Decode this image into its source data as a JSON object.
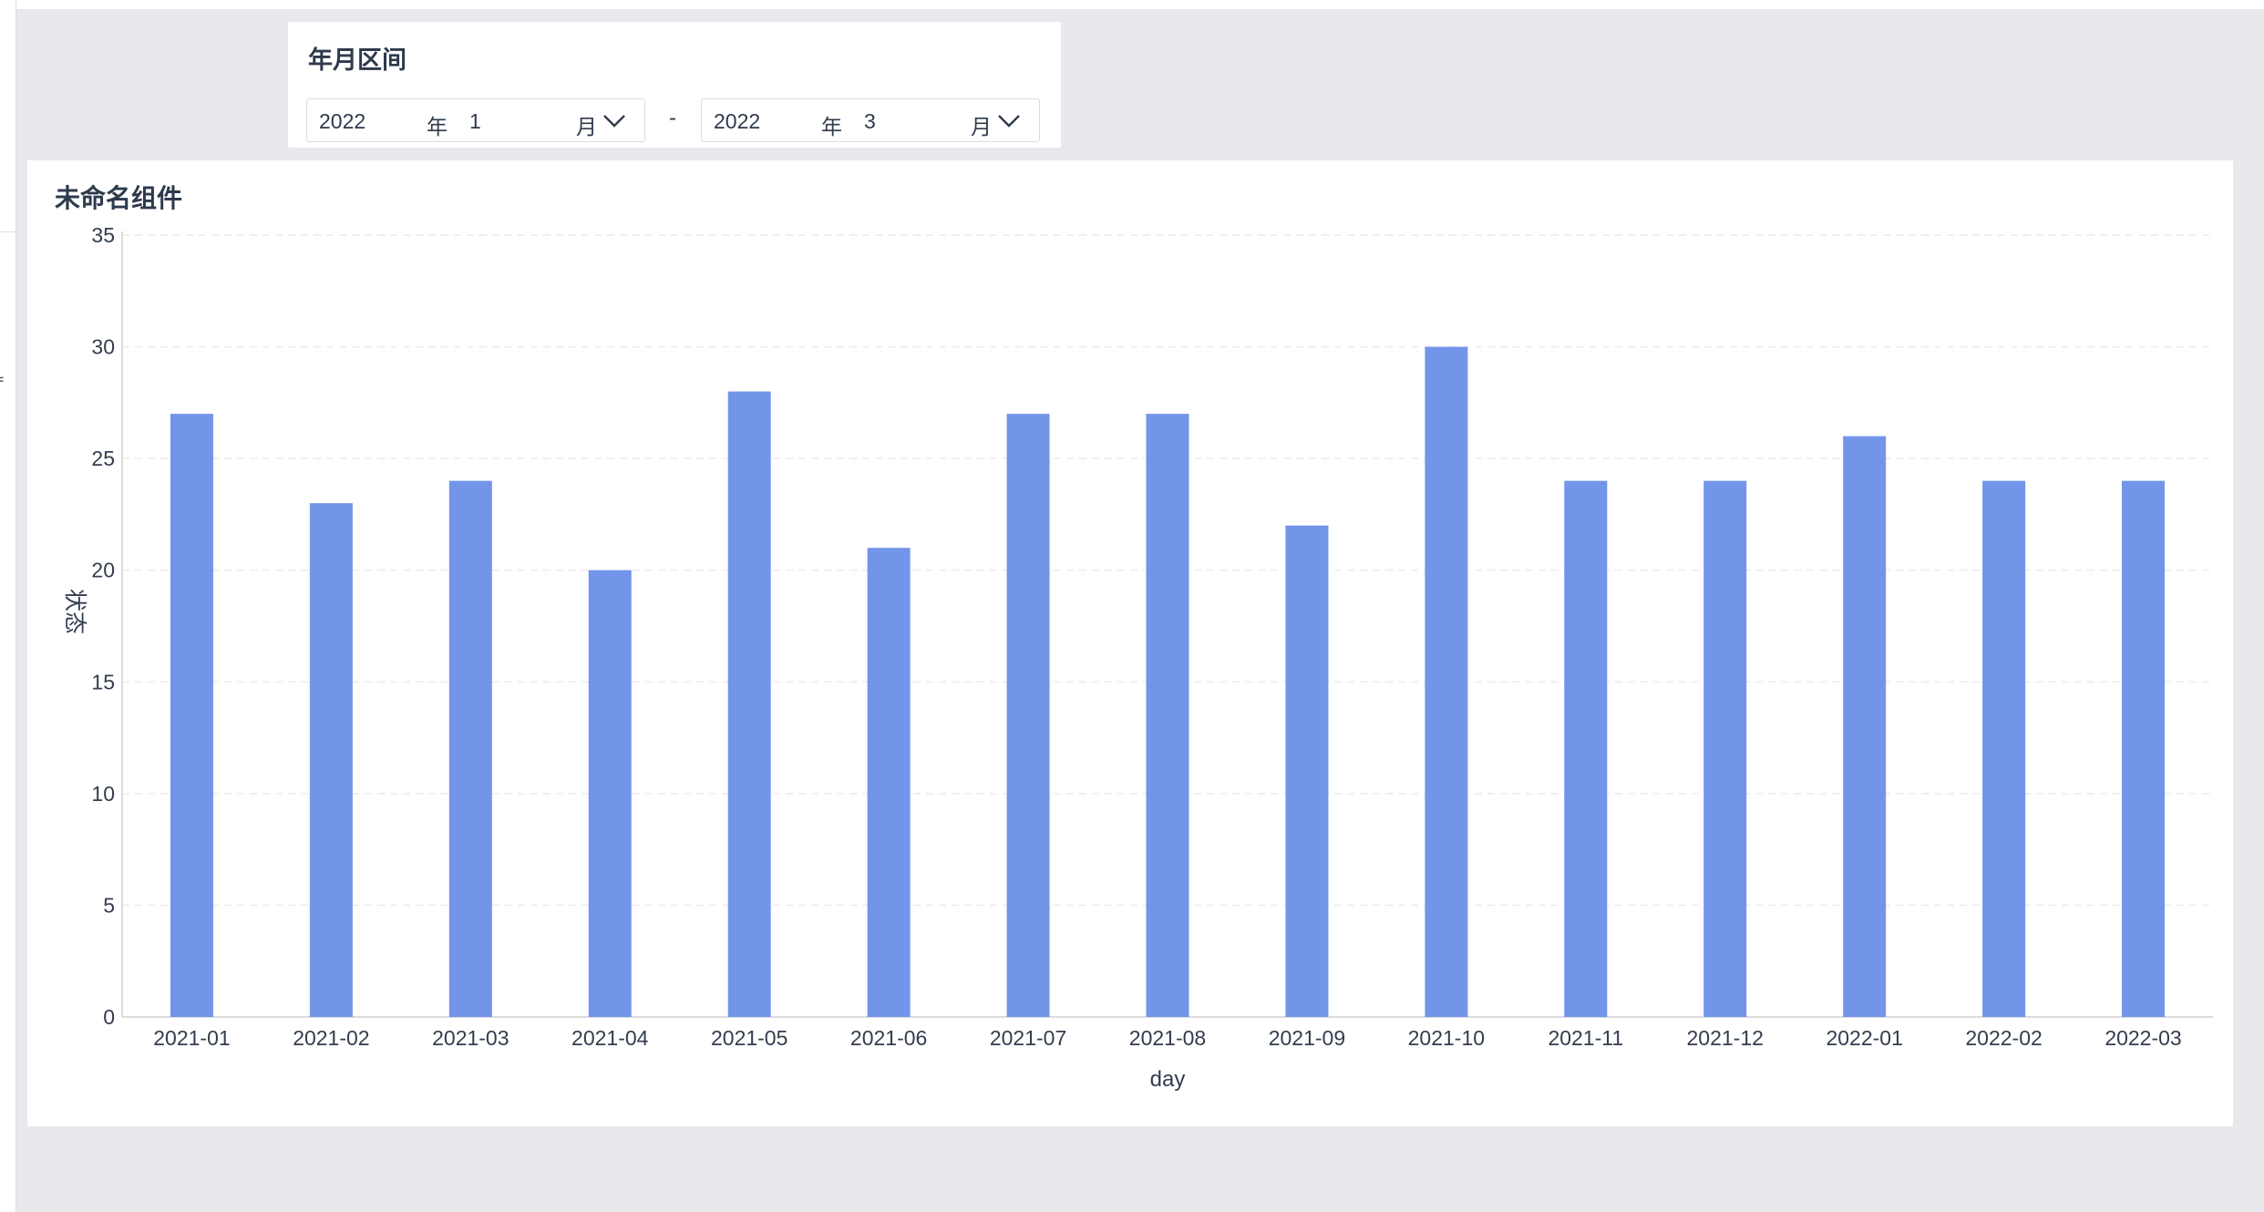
{
  "filter": {
    "title": "年月区间",
    "start": {
      "year": "2022",
      "year_unit": "年",
      "month": "1",
      "month_unit": "月"
    },
    "separator": "-",
    "end": {
      "year": "2022",
      "year_unit": "年",
      "month": "3",
      "month_unit": "月"
    }
  },
  "chart": {
    "title": "未命名组件"
  },
  "colors": {
    "bar": "#7295ea",
    "grid": "#ececec",
    "axis": "#cfcfcf",
    "text": "#333d4e"
  },
  "chart_data": {
    "type": "bar",
    "categories": [
      "2021-01",
      "2021-02",
      "2021-03",
      "2021-04",
      "2021-05",
      "2021-06",
      "2021-07",
      "2021-08",
      "2021-09",
      "2021-10",
      "2021-11",
      "2021-12",
      "2022-01",
      "2022-02",
      "2022-03"
    ],
    "values": [
      27,
      23,
      24,
      20,
      28,
      21,
      27,
      27,
      22,
      30,
      24,
      24,
      26,
      24,
      24
    ],
    "xlabel": "day",
    "ylabel": "状态",
    "ylim": [
      0,
      35
    ],
    "yticks": [
      0,
      5,
      10,
      15,
      20,
      25,
      30,
      35
    ],
    "grid": true,
    "legend": false
  }
}
